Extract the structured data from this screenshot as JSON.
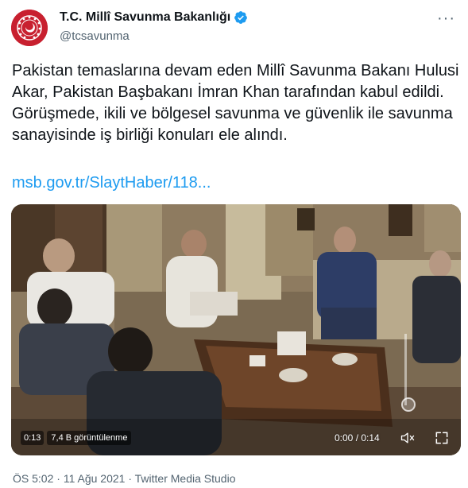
{
  "account": {
    "display_name": "T.C. Millî Savunma Bakanlığı",
    "handle": "@tcsavunma",
    "avatar_color": "#c8202f"
  },
  "more_button_label": "···",
  "tweet": {
    "text": "Pakistan temaslarına devam eden Millî Savunma Bakanı Hulusi Akar, Pakistan Başbakanı İmran Khan tarafından kabul edildi. Görüşmede, ikili ve bölgesel savunma ve güvenlik ile savunma sanayisinde iş birliği konuları ele alındı.",
    "link_text": "msb.gov.tr/SlaytHaber/118..."
  },
  "video": {
    "elapsed": "0:13",
    "views": "7,4 B görüntülenme",
    "time_display": "0:00 / 0:14",
    "mute_icon": "speaker-muted-icon",
    "fullscreen_icon": "fullscreen-icon"
  },
  "footer": {
    "time": "ÖS 5:02",
    "date": "11 Ağu 2021",
    "source": "Twitter Media Studio",
    "separator": "·",
    "full": "ÖS 5:02 · 11 Ağu 2021 · Twitter Media Studio"
  },
  "colors": {
    "link": "#1d9bf0",
    "text": "#0f1419",
    "secondary": "#536471",
    "verified": "#1d9bf0"
  }
}
